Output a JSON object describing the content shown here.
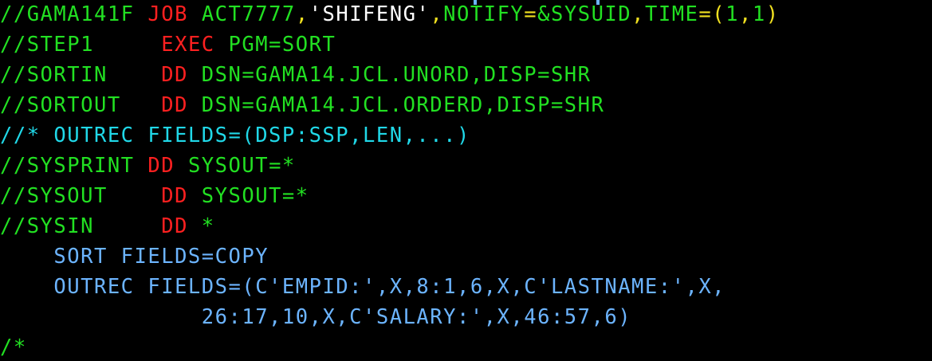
{
  "colors": {
    "green": "#22e022",
    "red": "#ff2020",
    "white": "#ffffff",
    "yellow": "#f0e020",
    "turquoise": "#20d8e8",
    "blue": "#6cb4ff",
    "background": "#000000"
  },
  "lines": [
    {
      "name": "job-card-line",
      "tokens": [
        {
          "t": "//GAMA141F ",
          "c": "green"
        },
        {
          "t": "JOB ",
          "c": "red"
        },
        {
          "t": "ACT7777",
          "c": "green"
        },
        {
          "t": ",",
          "c": "yellow"
        },
        {
          "t": "'SHIFENG'",
          "c": "white"
        },
        {
          "t": ",",
          "c": "yellow"
        },
        {
          "t": "NOTIFY",
          "c": "green"
        },
        {
          "t": "=",
          "c": "yellow"
        },
        {
          "t": "&SYSUID",
          "c": "green"
        },
        {
          "t": ",",
          "c": "yellow"
        },
        {
          "t": "TIME",
          "c": "green"
        },
        {
          "t": "=(",
          "c": "yellow"
        },
        {
          "t": "1",
          "c": "green"
        },
        {
          "t": ",",
          "c": "yellow"
        },
        {
          "t": "1",
          "c": "green"
        },
        {
          "t": ")",
          "c": "yellow"
        }
      ]
    },
    {
      "name": "step1-exec-line",
      "tokens": [
        {
          "t": "//STEP1     ",
          "c": "green"
        },
        {
          "t": "EXEC ",
          "c": "red"
        },
        {
          "t": "PGM=SORT",
          "c": "green"
        }
      ]
    },
    {
      "name": "sortin-dd-line",
      "tokens": [
        {
          "t": "//SORTIN    ",
          "c": "green"
        },
        {
          "t": "DD ",
          "c": "red"
        },
        {
          "t": "DSN=GAMA14.JCL.UNORD,DISP=SHR",
          "c": "green"
        }
      ]
    },
    {
      "name": "sortout-dd-line",
      "tokens": [
        {
          "t": "//SORTOUT   ",
          "c": "green"
        },
        {
          "t": "DD ",
          "c": "red"
        },
        {
          "t": "DSN=GAMA14.JCL.ORDERD,DISP=SHR",
          "c": "green"
        }
      ]
    },
    {
      "name": "comment-line",
      "tokens": [
        {
          "t": "//* OUTREC FIELDS=(DSP:SSP,LEN,...)",
          "c": "turquoise"
        }
      ]
    },
    {
      "name": "sysprint-dd-line",
      "tokens": [
        {
          "t": "//SYSPRINT ",
          "c": "green"
        },
        {
          "t": "DD ",
          "c": "red"
        },
        {
          "t": "SYSOUT=*",
          "c": "green"
        }
      ]
    },
    {
      "name": "sysout-dd-line",
      "tokens": [
        {
          "t": "//SYSOUT    ",
          "c": "green"
        },
        {
          "t": "DD ",
          "c": "red"
        },
        {
          "t": "SYSOUT=*",
          "c": "green"
        }
      ]
    },
    {
      "name": "sysin-dd-line",
      "tokens": [
        {
          "t": "//SYSIN     ",
          "c": "green"
        },
        {
          "t": "DD ",
          "c": "red"
        },
        {
          "t": "*",
          "c": "green"
        }
      ]
    },
    {
      "name": "sort-fields-line",
      "tokens": [
        {
          "t": "    SORT FIELDS=COPY",
          "c": "blue"
        }
      ]
    },
    {
      "name": "outrec-fields-line",
      "tokens": [
        {
          "t": "    OUTREC FIELDS=(C'EMPID:',X,8:1,6,X,C'LASTNAME:',X,",
          "c": "blue"
        }
      ]
    },
    {
      "name": "outrec-continuation-line",
      "tokens": [
        {
          "t": "               26:17,10,X,C'SALARY:',X,46:57,6)",
          "c": "blue"
        }
      ]
    },
    {
      "name": "end-of-data-line",
      "tokens": [
        {
          "t": "/*",
          "c": "green"
        }
      ]
    }
  ]
}
